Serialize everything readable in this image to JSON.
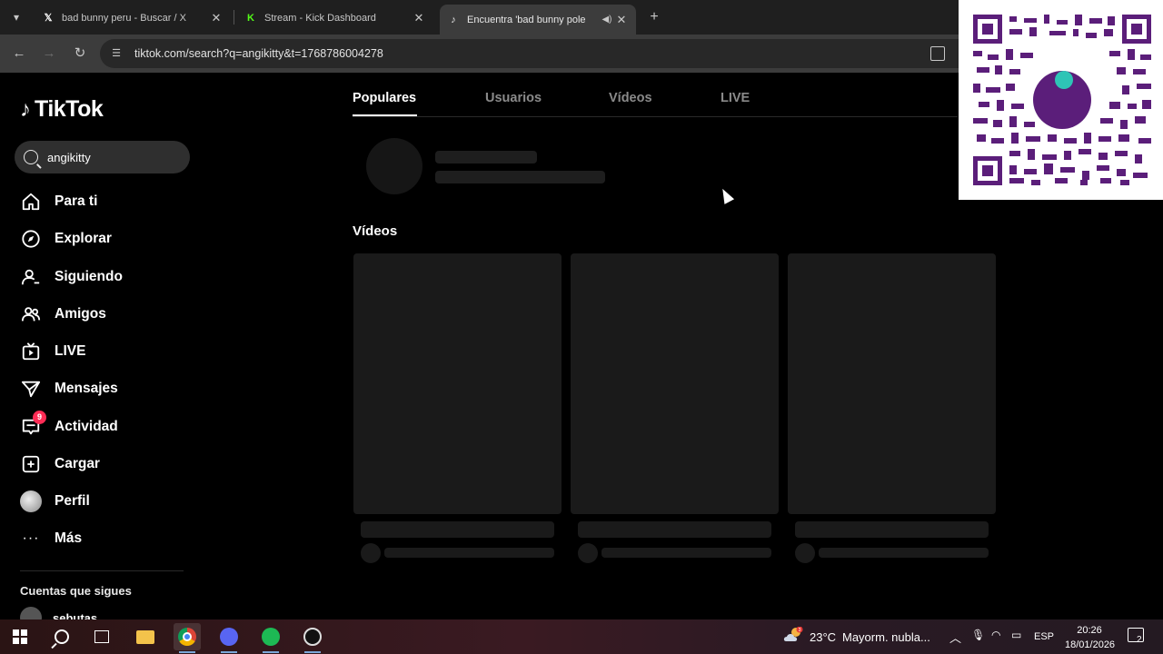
{
  "browser": {
    "tabs": [
      {
        "title": "bad bunny peru - Buscar / X",
        "icon": "x-logo-icon",
        "active": false
      },
      {
        "title": "Stream - Kick Dashboard",
        "icon": "kick-logo-icon",
        "active": false
      },
      {
        "title": "Encuentra 'bad bunny pole",
        "icon": "tiktok-logo-icon",
        "active": true,
        "audio": true
      }
    ],
    "url": "tiktok.com/search?q=angikitty&t=1768786004278"
  },
  "tiktok": {
    "logo_text": "TikTok",
    "search_value": "angikitty",
    "nav": [
      {
        "label": "Para ti",
        "icon": "home-icon"
      },
      {
        "label": "Explorar",
        "icon": "compass-icon"
      },
      {
        "label": "Siguiendo",
        "icon": "person-follow-icon"
      },
      {
        "label": "Amigos",
        "icon": "friends-icon"
      },
      {
        "label": "LIVE",
        "icon": "live-tv-icon"
      },
      {
        "label": "Mensajes",
        "icon": "send-icon"
      },
      {
        "label": "Actividad",
        "icon": "inbox-icon",
        "badge": "9"
      },
      {
        "label": "Cargar",
        "icon": "plus-square-icon"
      },
      {
        "label": "Perfil",
        "icon": "avatar"
      },
      {
        "label": "Más",
        "icon": "more-dots-icon"
      }
    ],
    "following_title": "Cuentas que sigues",
    "following_user": "sebutas",
    "result_tabs": [
      "Populares",
      "Usuarios",
      "Vídeos",
      "LIVE"
    ],
    "videos_section_title": "Vídeos"
  },
  "taskbar": {
    "weather_badge": "3",
    "temperature": "23°C",
    "weather_text": "Mayorm. nubla...",
    "language": "ESP",
    "time": "20:26",
    "date": "18/01/2026",
    "notification_count": "2"
  },
  "colors": {
    "tiktok_accent": "#fe2c55",
    "qr_purple": "#5b1e7a",
    "qr_badge": "#2ec4b6"
  }
}
